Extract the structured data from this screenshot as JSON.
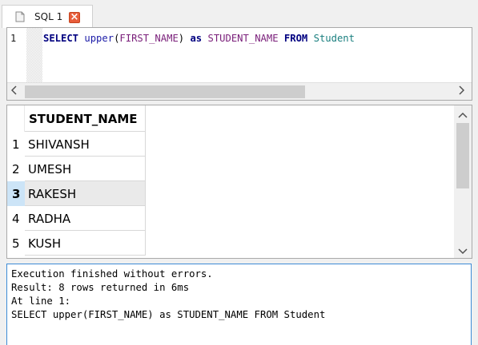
{
  "tab": {
    "label": "SQL 1",
    "doc_icon": "document-icon",
    "close_icon": "close-icon",
    "close_glyph": "×"
  },
  "editor": {
    "line_number": "1",
    "tokens": [
      {
        "text": "SELECT",
        "cls": "kw"
      },
      {
        "text": " ",
        "cls": "plain"
      },
      {
        "text": "upper",
        "cls": "fn"
      },
      {
        "text": "(",
        "cls": "plain"
      },
      {
        "text": "FIRST_NAME",
        "cls": "ident"
      },
      {
        "text": ")",
        "cls": "plain"
      },
      {
        "text": " ",
        "cls": "plain"
      },
      {
        "text": "as",
        "cls": "kw"
      },
      {
        "text": " ",
        "cls": "plain"
      },
      {
        "text": "STUDENT_NAME",
        "cls": "ident"
      },
      {
        "text": " ",
        "cls": "plain"
      },
      {
        "text": "FROM",
        "cls": "kw"
      },
      {
        "text": " ",
        "cls": "plain"
      },
      {
        "text": "Student",
        "cls": "tbl"
      }
    ],
    "scroll_left_glyph": "<",
    "scroll_right_glyph": ">"
  },
  "results": {
    "column": "STUDENT_NAME",
    "rows": [
      {
        "num": "1",
        "value": "SHIVANSH",
        "selected": false
      },
      {
        "num": "2",
        "value": "UMESH",
        "selected": false
      },
      {
        "num": "3",
        "value": "RAKESH",
        "selected": true
      },
      {
        "num": "4",
        "value": "RADHA",
        "selected": false
      },
      {
        "num": "5",
        "value": "KUSH",
        "selected": false
      }
    ],
    "scroll_up_glyph": "^",
    "scroll_down_glyph": "v"
  },
  "messages": {
    "lines": [
      "Execution finished without errors.",
      "Result: 8 rows returned in 6ms",
      "At line 1:",
      "SELECT upper(FIRST_NAME) as STUDENT_NAME FROM Student"
    ]
  }
}
